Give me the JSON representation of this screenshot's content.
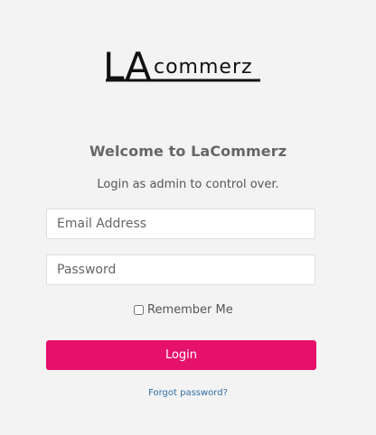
{
  "brand": {
    "logo_primary": "LA",
    "logo_secondary": "commerz"
  },
  "header": {
    "title": "Welcome to LaCommerz",
    "subtitle": "Login as admin to control over."
  },
  "form": {
    "email": {
      "value": "",
      "placeholder": "Email Address"
    },
    "password": {
      "value": "",
      "placeholder": "Password"
    },
    "remember_label": "Remember Me",
    "remember_checked": false,
    "login_label": "Login",
    "forgot_label": "Forgot password?"
  },
  "colors": {
    "page_background": "#f3f3f3",
    "accent": "#e5116b",
    "link": "#2f6fa7"
  },
  "icons": {
    "checkbox": "empty-checkbox-icon"
  }
}
